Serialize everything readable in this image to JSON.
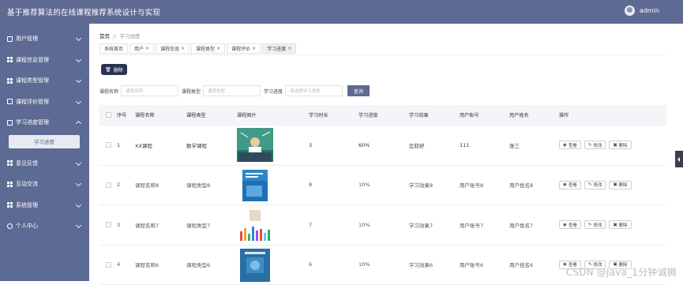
{
  "header": {
    "title": "基于推荐算法的在线课程推荐系统设计与实现",
    "user": "admin"
  },
  "sidebar": {
    "items": [
      {
        "label": "用户管理",
        "icon": "user-icon"
      },
      {
        "label": "课程信息管理",
        "icon": "grid-icon"
      },
      {
        "label": "课程类型管理",
        "icon": "grid-icon"
      },
      {
        "label": "课程评价管理",
        "icon": "doc-icon"
      },
      {
        "label": "学习进度管理",
        "icon": "doc-icon"
      },
      {
        "label": "意见反馈",
        "icon": "grid-icon"
      },
      {
        "label": "互动交流",
        "icon": "grid-icon"
      },
      {
        "label": "系统管理",
        "icon": "grid-icon"
      },
      {
        "label": "个人中心",
        "icon": "person-icon"
      }
    ],
    "submenu": "学习进度"
  },
  "breadcrumb": {
    "home": "首页",
    "sep": "//",
    "current": "学习进度"
  },
  "tabs": [
    {
      "label": "系统首页",
      "close": ""
    },
    {
      "label": "用户",
      "close": "×"
    },
    {
      "label": "课程信息",
      "close": "×"
    },
    {
      "label": "课程类型",
      "close": "×"
    },
    {
      "label": "课程评价",
      "close": "×"
    },
    {
      "label": "学习进度",
      "close": "×"
    }
  ],
  "toolbar": {
    "delete_label": "删除"
  },
  "search": {
    "course_name_label": "课程名称",
    "course_name_placeholder": "课程名称",
    "course_type_label": "课程类型",
    "course_type_placeholder": "课程类型",
    "progress_label": "学习进度",
    "progress_placeholder": "请选择学习进度",
    "query_label": "查询"
  },
  "table": {
    "headers": [
      "序号",
      "课程名称",
      "课程类型",
      "课程图片",
      "学习时长",
      "学习进度",
      "学习效果",
      "用户账号",
      "用户姓名",
      "操作"
    ],
    "rows": [
      {
        "no": "1",
        "name": "XX课程",
        "type": "数学课程",
        "duration": "3",
        "progress": "60%",
        "effect": "比较好",
        "account": "111",
        "username": "张三"
      },
      {
        "no": "2",
        "name": "课程名称8",
        "type": "课程类型8",
        "duration": "8",
        "progress": "10%",
        "effect": "学习效果8",
        "account": "用户账号8",
        "username": "用户姓名8"
      },
      {
        "no": "3",
        "name": "课程名称7",
        "type": "课程类型7",
        "duration": "7",
        "progress": "10%",
        "effect": "学习效果7",
        "account": "用户账号7",
        "username": "用户姓名7"
      },
      {
        "no": "4",
        "name": "课程名称6",
        "type": "课程类型6",
        "duration": "6",
        "progress": "10%",
        "effect": "学习效果6",
        "account": "用户账号6",
        "username": "用户姓名6"
      }
    ],
    "ops": {
      "view": "查看",
      "edit": "修改",
      "delete": "删除"
    }
  },
  "watermark": "CSDN @Java_1分钟诚狮"
}
